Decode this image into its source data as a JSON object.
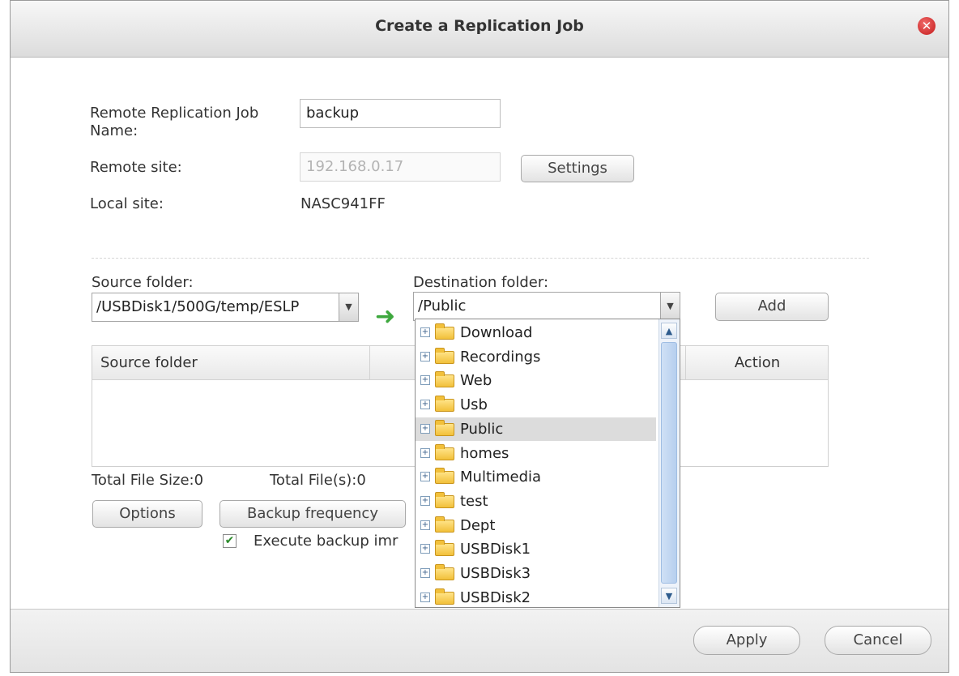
{
  "dialog": {
    "title": "Create a Replication Job",
    "close_icon": "close-circle-icon",
    "accent_close": "#c41a1a"
  },
  "job": {
    "name_label_line1": "Remote Replication Job",
    "name_label_line2": "Name:",
    "name_value": "backup",
    "remote_site_label": "Remote site:",
    "remote_site_value": "192.168.0.17",
    "settings_label": "Settings",
    "local_site_label": "Local site:",
    "local_site_value": "NASC941FF"
  },
  "folders": {
    "source_label": "Source folder:",
    "source_value": "/USBDisk1/500G/temp/ESLP",
    "destination_label": "Destination folder:",
    "destination_value": "/Public",
    "add_label": "Add",
    "arrow_icon": "right-arrow-icon"
  },
  "table": {
    "columns": [
      "Source folder",
      "Action"
    ]
  },
  "summary": {
    "total_size": "Total File Size:0",
    "total_files": "Total File(s):0"
  },
  "actions": {
    "options_label": "Options",
    "frequency_label": "Backup frequency",
    "execute_label": "Execute backup imr",
    "execute_checked": true
  },
  "dropdown": {
    "items": [
      {
        "label": "Download",
        "selected": false
      },
      {
        "label": "Recordings",
        "selected": false
      },
      {
        "label": "Web",
        "selected": false
      },
      {
        "label": "Usb",
        "selected": false
      },
      {
        "label": "Public",
        "selected": true
      },
      {
        "label": "homes",
        "selected": false
      },
      {
        "label": "Multimedia",
        "selected": false
      },
      {
        "label": "test",
        "selected": false
      },
      {
        "label": "Dept",
        "selected": false
      },
      {
        "label": "USBDisk1",
        "selected": false
      },
      {
        "label": "USBDisk3",
        "selected": false
      },
      {
        "label": "USBDisk2",
        "selected": false
      }
    ]
  },
  "footer": {
    "apply_label": "Apply",
    "cancel_label": "Cancel"
  }
}
